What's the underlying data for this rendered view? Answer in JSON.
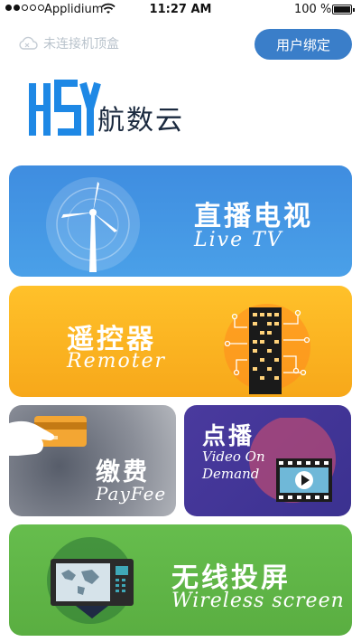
{
  "status_bar": {
    "carrier": "Applidium",
    "time": "11:27 AM",
    "battery_percent": "100 %",
    "icons": [
      "signal-dots-icon",
      "wifi-icon",
      "battery-icon"
    ]
  },
  "header": {
    "connection_status": "未连接机顶盒",
    "bind_button": "用户绑定",
    "accent_color": "#3a7ec9"
  },
  "brand": {
    "logo_name": "航数云"
  },
  "tiles": {
    "live_tv": {
      "zh": "直播电视",
      "en": "Live TV",
      "color": "#4498e5",
      "icon": "wind-turbine-icon"
    },
    "remote": {
      "zh": "遥控器",
      "en": "Remoter",
      "color": "#fbb424",
      "icon": "circuit-tower-icon"
    },
    "pay_fee": {
      "zh": "缴费",
      "en": "PayFee",
      "color": "#6d717c",
      "icon": "hand-card-icon"
    },
    "vod": {
      "zh": "点播",
      "en_line1": "Video On",
      "en_line2": "Demand",
      "color": "#433697",
      "icon": "film-play-icon"
    },
    "wireless": {
      "zh": "无线投屏",
      "en": "Wireless screen",
      "color": "#60b547",
      "icon": "tv-screen-icon"
    }
  }
}
